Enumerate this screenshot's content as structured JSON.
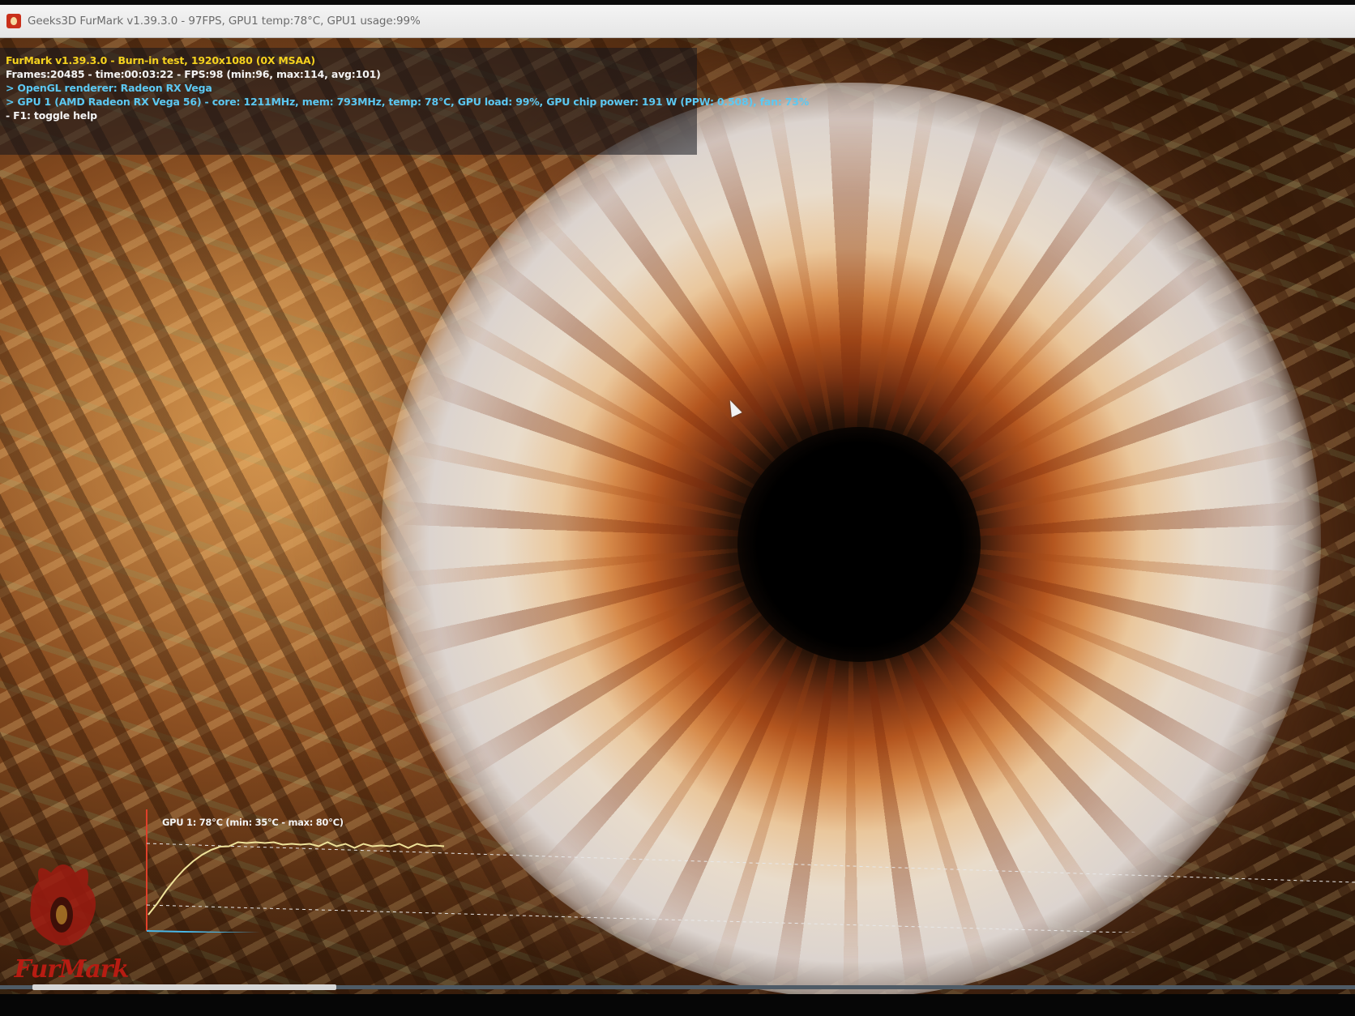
{
  "window": {
    "title": "Geeks3D FurMark v1.39.3.0 - 97FPS, GPU1 temp:78°C, GPU1 usage:99%",
    "icon": "furmark-app-icon"
  },
  "osd": {
    "line1": "FurMark v1.39.3.0 - Burn-in test, 1920x1080 (0X MSAA)",
    "line2": "Frames:20485 - time:00:03:22 - FPS:98 (min:96, max:114, avg:101)",
    "line3": "> OpenGL renderer: Radeon RX Vega",
    "line4": "> GPU 1 (AMD Radeon RX Vega 56) - core: 1211MHz, mem: 793MHz, temp: 78°C, GPU load: 99%, GPU chip power: 191 W (PPW: 0.508), fan: 73%",
    "line5": "- F1: toggle help",
    "colors": {
      "title": "#f5d21e",
      "stats": "#f4f4f4",
      "gpu_info": "#5cc8f2"
    }
  },
  "temperature_graph": {
    "label": "GPU 1: 78°C (min: 35°C - max: 80°C)",
    "line_color": "#efe39a",
    "axis_color_vertical": "#e0402a",
    "axis_color_horizontal": "#49b7e8",
    "readings_celsius": [
      35,
      42,
      50,
      57,
      63,
      68,
      72,
      75,
      77,
      78,
      79,
      80,
      79,
      80,
      79,
      79,
      78,
      79,
      78,
      78,
      79,
      78,
      78,
      77,
      78,
      78,
      77,
      78,
      78,
      77,
      78,
      78,
      77,
      78
    ]
  },
  "logo": {
    "text": "FurMark",
    "color": "#b71c12"
  }
}
